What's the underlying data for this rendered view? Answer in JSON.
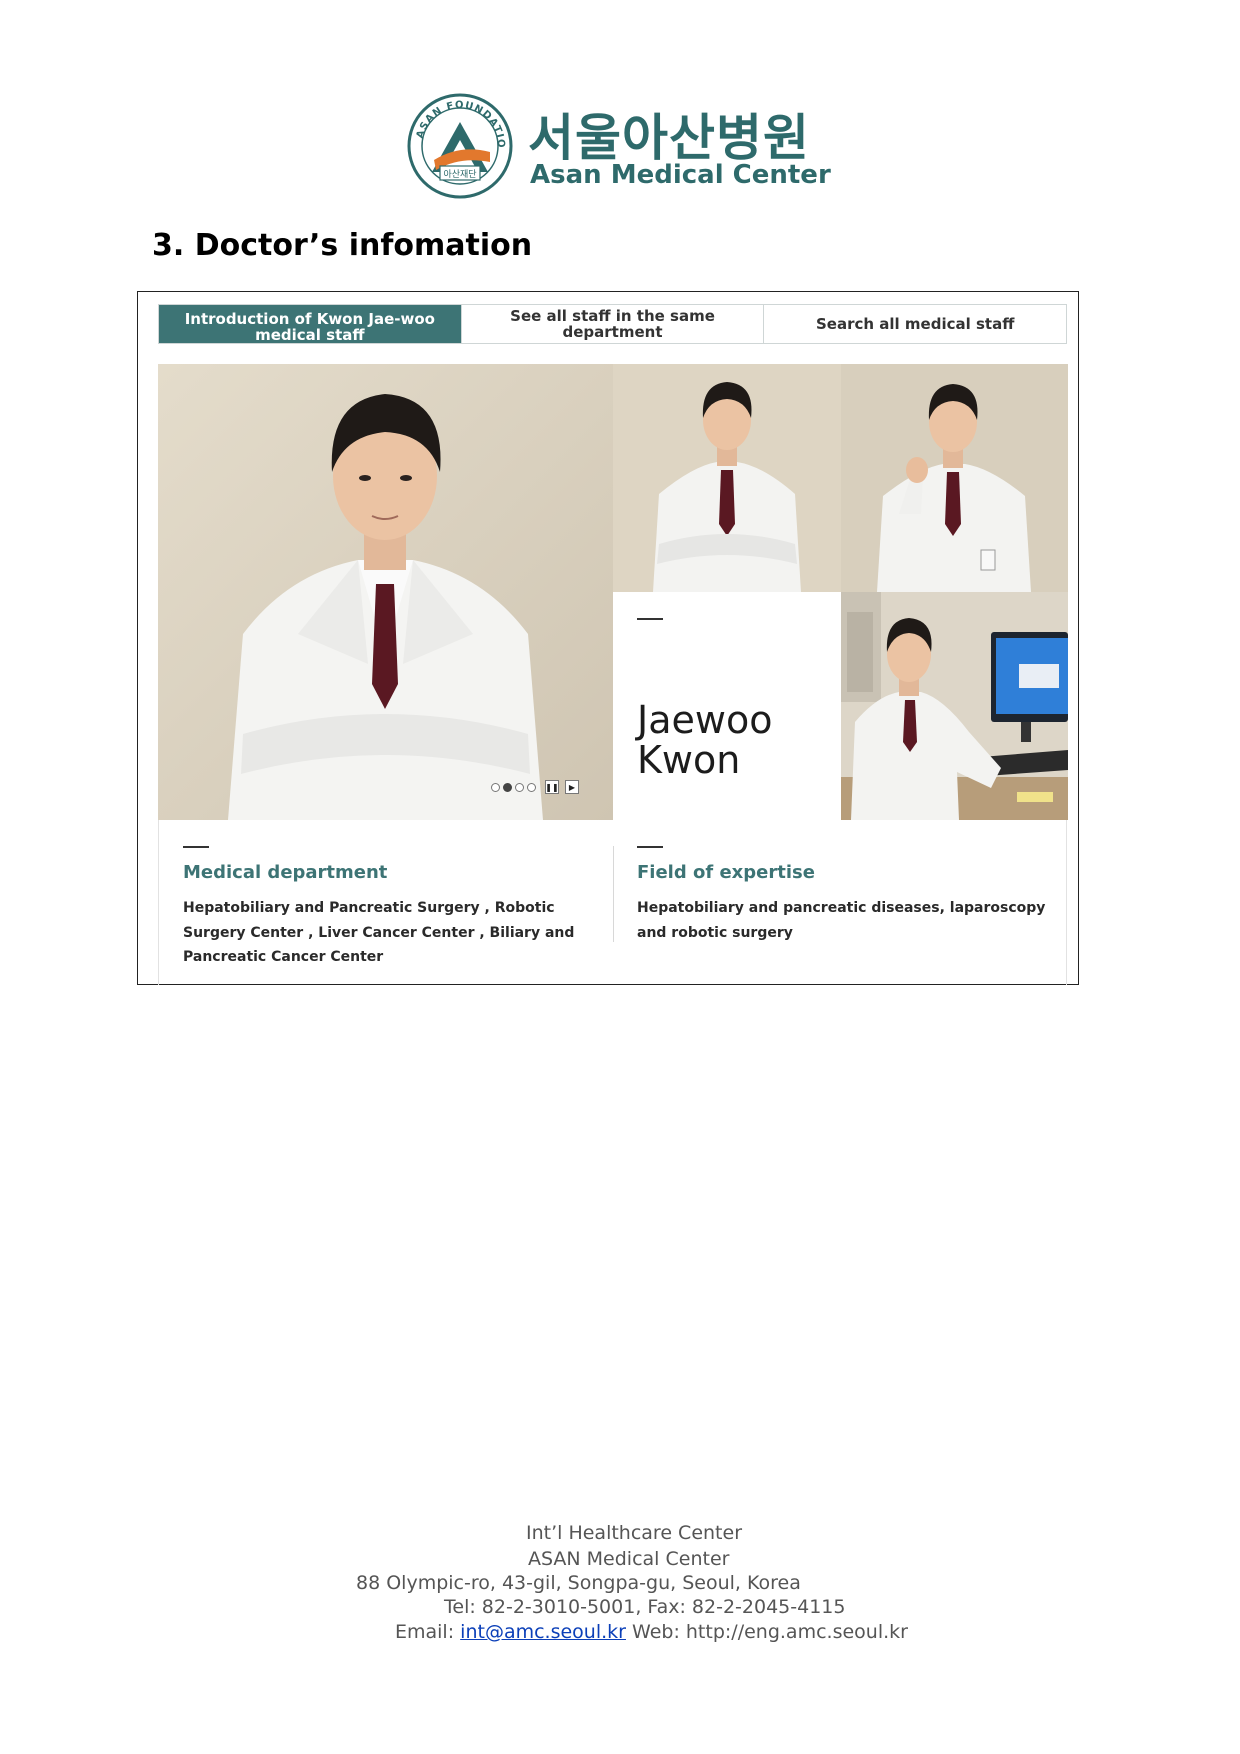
{
  "header": {
    "logo_korean": "서울아산병원",
    "logo_english": "Asan Medical Center",
    "seal_text_top": "ASAN FOUNDATION",
    "seal_text_bottom": "아산재단"
  },
  "section_title": "3. Doctor’s infomation",
  "tabs": [
    {
      "label": "Introduction of Kwon Jae-woo medical staff",
      "active": true
    },
    {
      "label": "See all staff in the same department",
      "active": false
    },
    {
      "label": "Search all medical staff",
      "active": false
    }
  ],
  "profile": {
    "name_line1": "Jaewoo",
    "name_line2": "Kwon",
    "slider": {
      "slide_count": 4,
      "active_slide": 2
    }
  },
  "info": {
    "department_heading": "Medical department",
    "department_text": "Hepatobiliary and Pancreatic Surgery , Robotic Surgery Center , Liver Cancer Center , Biliary and Pancreatic Cancer Center",
    "expertise_heading": "Field of expertise",
    "expertise_text": "Hepatobiliary and pancreatic diseases, laparoscopy and robotic surgery"
  },
  "footer": {
    "line1": "Int’l Healthcare Center",
    "line2": "ASAN Medical Center",
    "line3": "88 Olympic-ro, 43-gil, Songpa-gu, Seoul, Korea",
    "line4": "Tel: 82-2-3010-5001, Fax: 82-2-2045-4115",
    "email_label": "Email:",
    "email": "int@amc.seoul.kr",
    "web_label": "Web:",
    "web": "http://eng.amc.seoul.kr"
  },
  "colors": {
    "brand_teal": "#3d7475",
    "logo_teal": "#2e6a6b",
    "logo_orange": "#e2782d",
    "link_blue": "#0b3fb8"
  }
}
